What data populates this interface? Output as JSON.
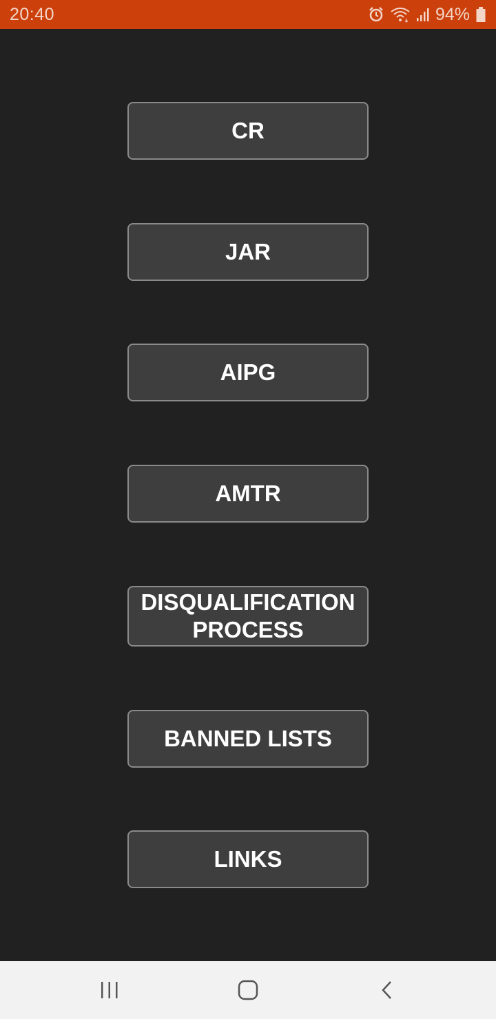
{
  "status_bar": {
    "time": "20:40",
    "battery_percent": "94%",
    "icons": [
      "alarm-icon",
      "wifi-icon",
      "signal-icon",
      "battery-icon"
    ],
    "background_color": "#cc400c"
  },
  "menu": {
    "buttons": [
      {
        "label": "CR"
      },
      {
        "label": "JAR"
      },
      {
        "label": "AIPG"
      },
      {
        "label": "AMTR"
      },
      {
        "label_line1": "DISQUALIFICATION",
        "label_line2": "PROCESS"
      },
      {
        "label": "BANNED LISTS"
      },
      {
        "label": "LINKS"
      }
    ]
  },
  "nav_bar": {
    "icons": [
      "recent-apps-icon",
      "home-icon",
      "back-icon"
    ]
  }
}
